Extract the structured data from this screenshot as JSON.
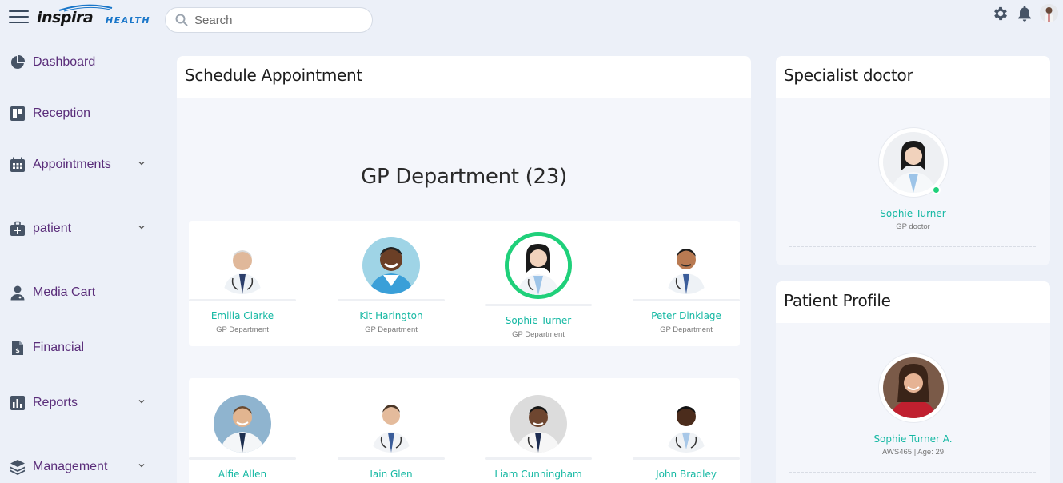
{
  "header": {
    "logo_main": "inspira",
    "logo_sub": "HEALTH",
    "search_placeholder": "Search",
    "icons": [
      "menu-icon",
      "search-icon",
      "gear-icon",
      "bell-icon",
      "user-avatar"
    ]
  },
  "sidebar": {
    "items": [
      {
        "label": "Dashboard",
        "icon": "pie-chart-icon",
        "has_chevron": false
      },
      {
        "label": "Reception",
        "icon": "board-icon",
        "has_chevron": false
      },
      {
        "label": "Appointments",
        "icon": "calendar-icon",
        "has_chevron": true
      },
      {
        "label": "patient",
        "icon": "medical-kit-icon",
        "has_chevron": true
      },
      {
        "label": "Media Cart",
        "icon": "doctor-user-icon",
        "has_chevron": false
      },
      {
        "label": "Financial",
        "icon": "invoice-icon",
        "has_chevron": false
      },
      {
        "label": "Reports",
        "icon": "bar-chart-icon",
        "has_chevron": true
      },
      {
        "label": "Management",
        "icon": "layers-icon",
        "has_chevron": true
      }
    ]
  },
  "schedule": {
    "title": "Schedule Appointment",
    "department_title": "GP Department (23)",
    "doctors_row1": [
      {
        "name": "Emilia Clarke",
        "department": "GP Department"
      },
      {
        "name": "Kit Harington",
        "department": "GP Department"
      },
      {
        "name": "Sophie Turner",
        "department": "GP Department",
        "selected": true
      },
      {
        "name": "Peter Dinklage",
        "department": "GP Department"
      }
    ],
    "doctors_row2": [
      {
        "name": "Alfie Allen"
      },
      {
        "name": "Iain Glen"
      },
      {
        "name": "Liam Cunningham"
      },
      {
        "name": "John Bradley"
      }
    ]
  },
  "specialist": {
    "title": "Specialist doctor",
    "name": "Sophie Turner",
    "role": "GP doctor",
    "status": "online"
  },
  "patient_profile": {
    "title": "Patient Profile",
    "name": "Sophie Turner A.",
    "details": "AWS465 | Age: 29"
  },
  "colors": {
    "accent_teal": "#15b8a3",
    "online_green": "#1fd07a",
    "nav_purple": "#5a2d7a",
    "brand_blue": "#1976c9",
    "background": "#ecf0f8"
  }
}
